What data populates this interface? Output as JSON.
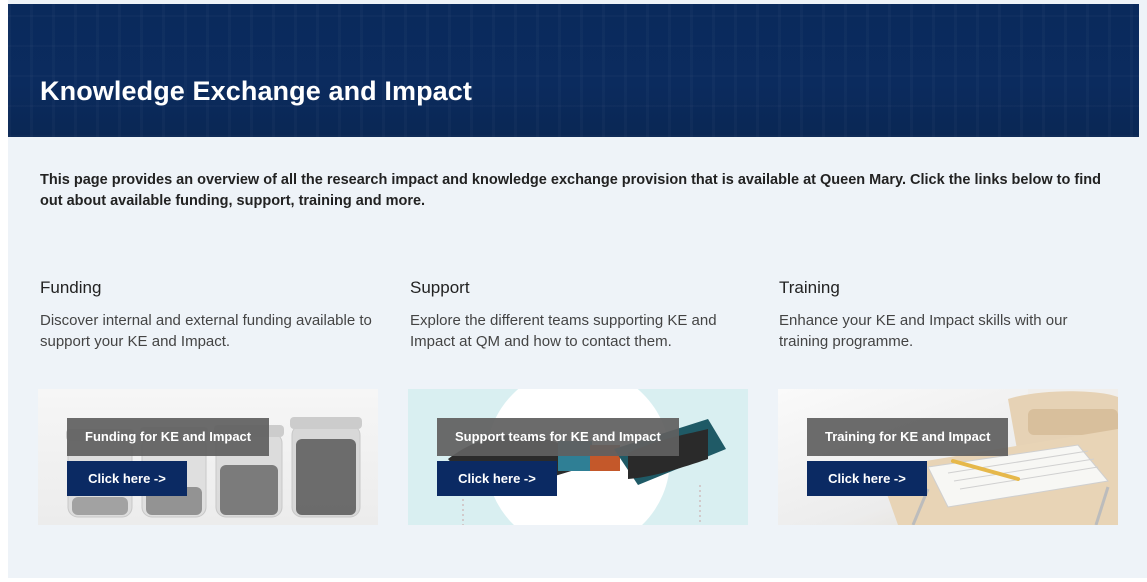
{
  "header": {
    "title": "Knowledge Exchange and Impact"
  },
  "intro": "This page provides an overview of all the research impact and knowledge exchange provision that is available at Queen Mary. Click the links below to find out about available funding, support, training and more.",
  "sections": [
    {
      "heading": "Funding",
      "description": "Discover internal and external funding available to support your KE and Impact.",
      "card_label": "Funding for KE and Impact",
      "button_label": "Click here ->"
    },
    {
      "heading": "Support",
      "description": "Explore the different teams supporting KE and Impact at QM and how to contact them.",
      "card_label": "Support teams for KE and Impact",
      "button_label": "Click here ->"
    },
    {
      "heading": "Training",
      "description": "Enhance your KE and Impact skills with our training programme.",
      "card_label": "Training for KE and Impact",
      "button_label": "Click here ->"
    }
  ],
  "colors": {
    "hero": "#0b2b5e",
    "button": "#0b2a63",
    "label_bg": "#606060",
    "page_bg": "#eef3f8"
  },
  "icons": {
    "funding": "coin-jars-image",
    "support": "puzzle-hands-image",
    "training": "desk-notebook-image"
  }
}
